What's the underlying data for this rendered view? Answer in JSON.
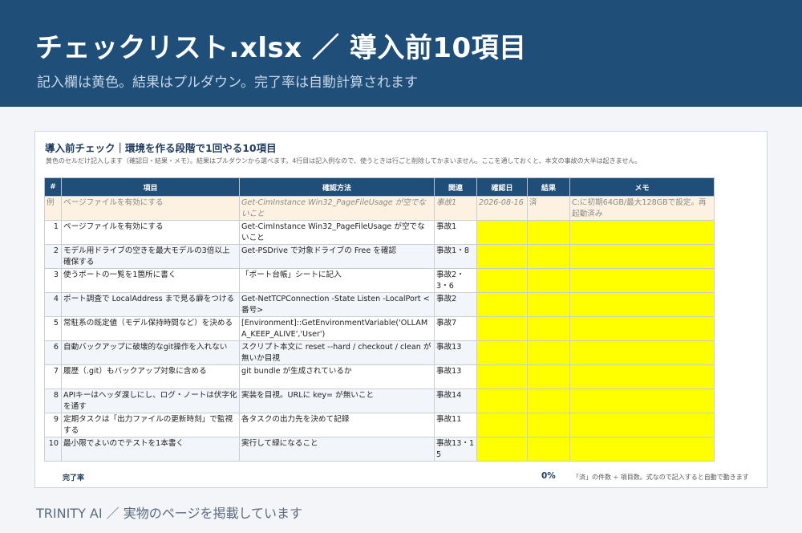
{
  "banner": {
    "title": "チェックリスト.xlsx ／ 導入前10項目",
    "subtitle": "記入欄は黄色。結果はプルダウン。完了率は自動計算されます"
  },
  "sheet": {
    "title": "導入前チェック｜環境を作る段階で1回やる10項目",
    "note": "黄色のセルだけ記入します（確認日・結果・メモ）。結果はプルダウンから選べます。4行目は記入例なので、使うときは行ごと削除してかまいません。ここを通しておくと、本文の事故の大半は起きません。",
    "headers": [
      "#",
      "項目",
      "確認方法",
      "関連",
      "確認日",
      "結果",
      "メモ"
    ],
    "example": {
      "num": "例",
      "item": "ページファイルを有効にする",
      "method": "Get-CimInstance Win32_PageFileUsage が空でないこと",
      "related": "事故1",
      "date": "2026-08-16",
      "result": "済",
      "memo": "C:に初期64GB/最大128GBで設定。再起動済み"
    },
    "rows": [
      {
        "num": "1",
        "item": "ページファイルを有効にする",
        "method": "Get-CimInstance Win32_PageFileUsage が空でないこと",
        "related": "事故1"
      },
      {
        "num": "2",
        "item": "モデル用ドライブの空きを最大モデルの3倍以上確保する",
        "method": "Get-PSDrive で対象ドライブの Free を確認",
        "related": "事故1・8"
      },
      {
        "num": "3",
        "item": "使うポートの一覧を1箇所に書く",
        "method": "「ポート台帳」シートに記入",
        "related": "事故2・3・6"
      },
      {
        "num": "4",
        "item": "ポート調査で LocalAddress まで見る癖をつける",
        "method": "Get-NetTCPConnection -State Listen -LocalPort <番号>",
        "related": "事故2"
      },
      {
        "num": "5",
        "item": "常駐系の既定値（モデル保持時間など）を決める",
        "method": "[Environment]::GetEnvironmentVariable('OLLAMA_KEEP_ALIVE','User')",
        "related": "事故7"
      },
      {
        "num": "6",
        "item": "自動バックアップに破壊的なgit操作を入れない",
        "method": "スクリプト本文に reset --hard / checkout / clean が無いか目視",
        "related": "事故13"
      },
      {
        "num": "7",
        "item": "履歴（.git）もバックアップ対象に含める",
        "method": "git bundle が生成されているか",
        "related": "事故13"
      },
      {
        "num": "8",
        "item": "APIキーはヘッダ渡しにし、ログ・ノートは伏字化を通す",
        "method": "実装を目視。URLに key= が無いこと",
        "related": "事故14"
      },
      {
        "num": "9",
        "item": "定期タスクは「出力ファイルの更新時刻」で監視する",
        "method": "各タスクの出力先を決めて記録",
        "related": "事故11"
      },
      {
        "num": "10",
        "item": "最小限でよいのでテストを1本書く",
        "method": "実行して緑になること",
        "related": "事故13・15"
      }
    ],
    "completion": {
      "label": "完了率",
      "value": "0%",
      "note": "「済」の件数 ÷ 項目数。式なので記入すると自動で動きます"
    }
  },
  "footer": "TRINITY AI ／ 実物のページを掲載しています"
}
